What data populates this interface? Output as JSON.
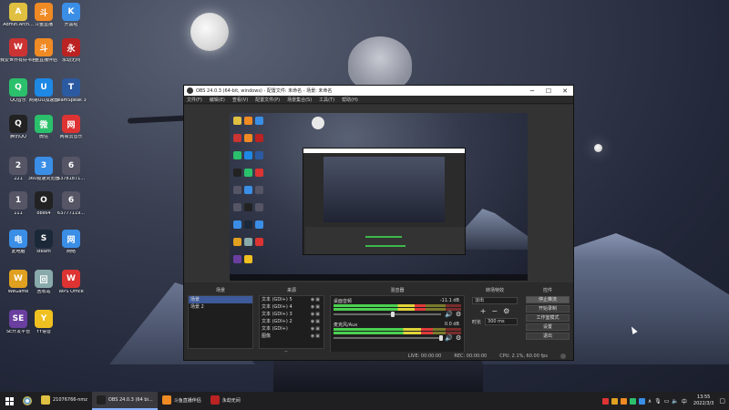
{
  "desktop": {
    "icons": [
      {
        "label": "Admin.Arch...",
        "color": "#e0c040",
        "glyph": "A"
      },
      {
        "label": "斗鱼直播",
        "color": "#f08a24",
        "glyph": "斗"
      },
      {
        "label": "开黑啦",
        "color": "#3a8ee6",
        "glyph": "K"
      },
      {
        "label": "我爱世界有好平台",
        "color": "#c33",
        "glyph": "W"
      },
      {
        "label": "斗鱼直播伴侣",
        "color": "#f08a24",
        "glyph": "斗"
      },
      {
        "label": "永劫无间",
        "color": "#b22",
        "glyph": "永"
      },
      {
        "label": "QQ音乐",
        "color": "#2bc06b",
        "glyph": "Q"
      },
      {
        "label": "网易UU加速器",
        "color": "#1e88e5",
        "glyph": "U"
      },
      {
        "label": "TeamSpeak 3",
        "color": "#2c5aa0",
        "glyph": "T"
      },
      {
        "label": "腾讯QQ",
        "color": "#222",
        "glyph": "Q"
      },
      {
        "label": "微信",
        "color": "#2bc06b",
        "glyph": "微"
      },
      {
        "label": "网易云音乐",
        "color": "#d33",
        "glyph": "网"
      },
      {
        "label": "221",
        "color": "#556",
        "glyph": "2"
      },
      {
        "label": "360极速浏览器",
        "color": "#3a8ee6",
        "glyph": "3"
      },
      {
        "label": "63781871...",
        "color": "#556",
        "glyph": "6"
      },
      {
        "label": "111",
        "color": "#556",
        "glyph": "1"
      },
      {
        "label": "obs64",
        "color": "#222",
        "glyph": "O"
      },
      {
        "label": "63777119...",
        "color": "#556",
        "glyph": "6"
      },
      {
        "label": "此电脑",
        "color": "#3a8ee6",
        "glyph": "电"
      },
      {
        "label": "steam",
        "color": "#1b2838",
        "glyph": "S"
      },
      {
        "label": "网络",
        "color": "#3a8ee6",
        "glyph": "网"
      },
      {
        "label": "WeGame",
        "color": "#e0a020",
        "glyph": "W"
      },
      {
        "label": "回收站",
        "color": "#8aa",
        "glyph": "回"
      },
      {
        "label": "WPS Office",
        "color": "#d33",
        "glyph": "W"
      },
      {
        "label": "SE开发平台",
        "color": "#6a3fa0",
        "glyph": "SE"
      },
      {
        "label": "YY语音",
        "color": "#f0c020",
        "glyph": "Y"
      }
    ]
  },
  "obs": {
    "title": "OBS 24.0.3 (64-bit, windows) - 配置文件: 未命名 - 场景: 未命名",
    "menu": [
      "文件(F)",
      "编辑(E)",
      "查看(V)",
      "配置文件(P)",
      "场景集合(S)",
      "工具(T)",
      "帮助(H)"
    ],
    "scenes": {
      "header": "场景",
      "items": [
        "场景",
        "场景 2"
      ],
      "selected": 0
    },
    "sources": {
      "header": "来源",
      "items": [
        "文本 (GDI+) 5",
        "文本 (GDI+) 4",
        "文本 (GDI+) 3",
        "文本 (GDI+) 2",
        "文本 (GDI+)",
        "图像"
      ]
    },
    "mixer": {
      "header": "混音器",
      "channels": [
        {
          "name": "桌面音频",
          "db": "-11.1 dB",
          "level": 0.72,
          "volume": 0.55
        },
        {
          "name": "麦克风/Aux",
          "db": "0.0 dB",
          "level": 0.78,
          "volume": 1.0
        }
      ]
    },
    "transitions": {
      "header": "转场特效",
      "type": "淡出",
      "duration_label": "时长",
      "duration_value": "300 ms"
    },
    "controls": {
      "header": "控件",
      "buttons": [
        "停止推流",
        "开始录制",
        "工作室模式",
        "设置",
        "退出"
      ]
    },
    "status": {
      "live": "LIVE: 00:00:00",
      "rec": "REC: 00:00:00",
      "cpu": "CPU: 2.1%, 60.00 fps"
    }
  },
  "taskbar": {
    "apps": [
      {
        "label": "21076766-nmz",
        "color": "#e0c040",
        "active": false
      },
      {
        "label": "OBS 24.0.3 (64 bi...",
        "color": "#222",
        "active": true
      },
      {
        "label": "斗鱼直播伴侣",
        "color": "#f08a24",
        "active": false
      },
      {
        "label": "永劫无间",
        "color": "#b22",
        "active": false
      }
    ],
    "time": "13:55",
    "date": "2022/3/3"
  }
}
